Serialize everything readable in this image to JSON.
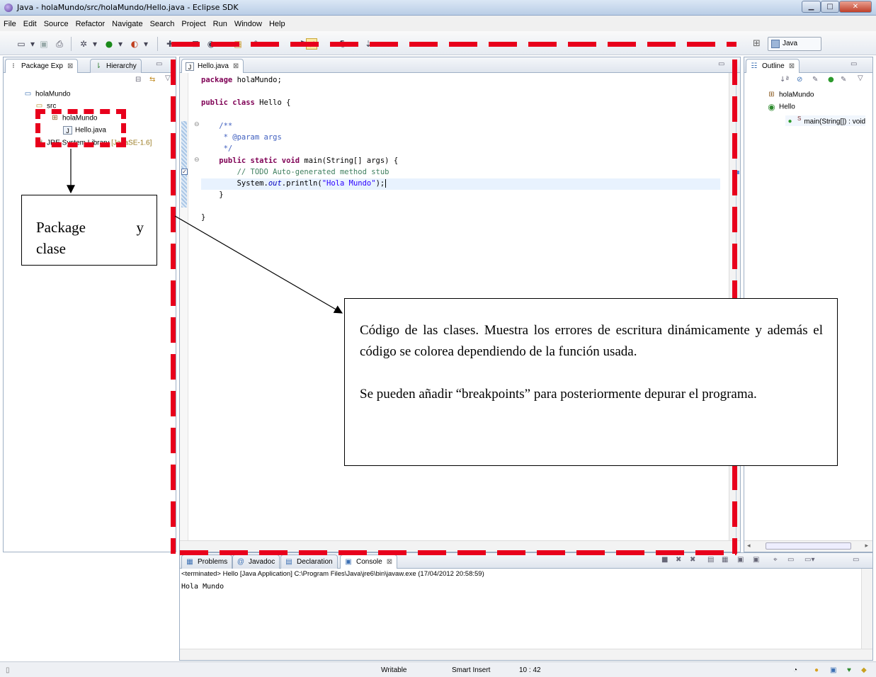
{
  "window": {
    "title": "Java - holaMundo/src/holaMundo/Hello.java - Eclipse SDK"
  },
  "menu": [
    "File",
    "Edit",
    "Source",
    "Refactor",
    "Navigate",
    "Search",
    "Project",
    "Run",
    "Window",
    "Help"
  ],
  "perspective": {
    "label": "Java"
  },
  "left_panel": {
    "tabs": [
      {
        "label": "Package Exp"
      },
      {
        "label": "Hierarchy"
      }
    ],
    "tree": [
      {
        "label": "holaMundo"
      },
      {
        "label": "src"
      },
      {
        "label": "holaMundo"
      },
      {
        "label": "Hello.java"
      },
      {
        "label": "JRE System Library",
        "suffix": "[JavaSE-1.6]"
      }
    ]
  },
  "editor": {
    "tab": "Hello.java",
    "lines": {
      "l1_kw": "package",
      "l1_rest": " holaMundo;",
      "l2_kw": "public class",
      "l2_rest": " Hello {",
      "l3": "    /**",
      "l4": "     * @param args",
      "l5": "     */",
      "l6_kw": "    public static void",
      "l6_rest": " main(String[] args) {",
      "l7": "        // TODO Auto-generated method stub",
      "l8_a": "        System.",
      "l8_field": "out",
      "l8_b": ".println(",
      "l8_str": "\"Hola Mundo\"",
      "l8_c": ");",
      "l9": "    }",
      "l10": "}"
    }
  },
  "outline": {
    "tab": "Outline",
    "tree": [
      {
        "label": "holaMundo"
      },
      {
        "label": "Hello"
      },
      {
        "label": "main(String[]) : void"
      }
    ]
  },
  "bottom": {
    "tabs": [
      {
        "label": "Problems"
      },
      {
        "label": "Javadoc"
      },
      {
        "label": "Declaration"
      },
      {
        "label": "Console"
      }
    ],
    "console_header": "<terminated> Hello [Java Application] C:\\Program Files\\Java\\jre6\\bin\\javaw.exe (17/04/2012 20:58:59)",
    "console_output": "Hola Mundo"
  },
  "status": {
    "writable": "Writable",
    "insert_mode": "Smart Insert",
    "position": "10 : 42"
  },
  "callouts": {
    "package": {
      "line1_a": "Package",
      "line1_b": "y",
      "line2": "clase"
    },
    "code": {
      "p1": "Código de las clases. Muestra los errores de escritura dinámicamente y además el código se colorea dependiendo de la función usada.",
      "p2": "Se pueden añadir “breakpoints” para posteriormente depurar el programa."
    }
  },
  "colors": {
    "annotation_red": "#e8001c",
    "keyword": "#7f0055",
    "comment": "#3f7f5f",
    "javadoc": "#3f5fbf",
    "string": "#2a00ff"
  }
}
